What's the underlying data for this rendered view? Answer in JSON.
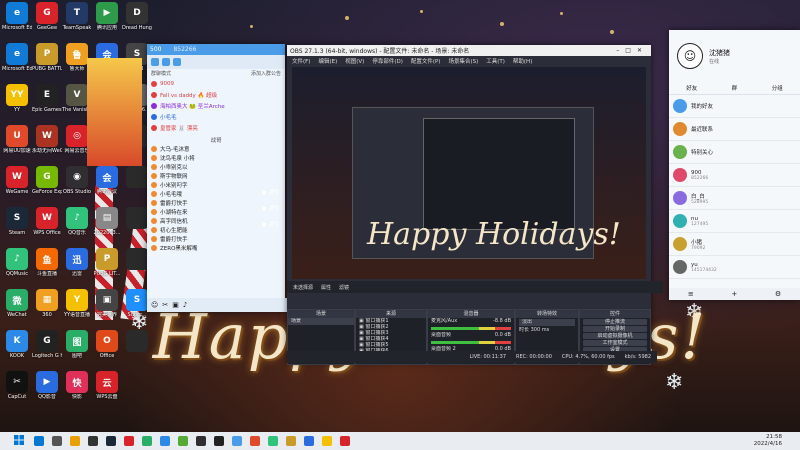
{
  "desktop_icons": [
    {
      "label": "Microsoft Edge",
      "color": "#0f7bd6",
      "glyph": "e"
    },
    {
      "label": "GeeGee",
      "color": "#d8232a",
      "glyph": "G"
    },
    {
      "label": "TeamSpeak",
      "color": "#233a66",
      "glyph": "T"
    },
    {
      "label": "腾讯应用",
      "color": "#2e9b4a",
      "glyph": "▶"
    },
    {
      "label": "Dread Hunger",
      "color": "#333",
      "glyph": "D"
    },
    {
      "label": "Microsoft Edge",
      "color": "#0f7bd6",
      "glyph": "e"
    },
    {
      "label": "PUBG BATTLEGR...",
      "color": "#c89b2a",
      "glyph": "P"
    },
    {
      "label": "鲁大师",
      "color": "#f0a020",
      "glyph": "鲁"
    },
    {
      "label": "腾讯会议",
      "color": "#2a6be0",
      "glyph": "会"
    },
    {
      "label": "SE5B",
      "color": "#444",
      "glyph": "S"
    },
    {
      "label": "YY",
      "color": "#f5c000",
      "glyph": "YY"
    },
    {
      "label": "Epic Games Launcher",
      "color": "#222",
      "glyph": "E"
    },
    {
      "label": "The Vanishing...",
      "color": "#554",
      "glyph": "V"
    },
    {
      "label": "KOOK",
      "color": "#2b8ae8",
      "glyph": "K"
    },
    {
      "label": "2022年6...",
      "color": "#666",
      "glyph": "W"
    },
    {
      "label": "网易UU加速",
      "color": "#e04a2a",
      "glyph": "U"
    },
    {
      "label": "永劫无间WeGame版",
      "color": "#a32",
      "glyph": "W"
    },
    {
      "label": "网易云音乐",
      "color": "#d8232a",
      "glyph": "◎"
    },
    {
      "label": "虎牙直播",
      "color": "#f5a800",
      "glyph": "虎"
    },
    {
      "label": "",
      "color": "#2a2a2a",
      "glyph": ""
    },
    {
      "label": "WeGame",
      "color": "#d8232a",
      "glyph": "W"
    },
    {
      "label": "GeForce Experience",
      "color": "#76b900",
      "glyph": "G"
    },
    {
      "label": "OBS Studio",
      "color": "#302e31",
      "glyph": "◉"
    },
    {
      "label": "腾讯会议",
      "color": "#2a6be0",
      "glyph": "会"
    },
    {
      "label": "",
      "color": "#2a2a2a",
      "glyph": ""
    },
    {
      "label": "Steam",
      "color": "#1b2838",
      "glyph": "S"
    },
    {
      "label": "WPS Office",
      "color": "#d8232a",
      "glyph": "W"
    },
    {
      "label": "QQ音乐",
      "color": "#31c27c",
      "glyph": "♪"
    },
    {
      "label": "2022063...",
      "color": "#888",
      "glyph": "▤"
    },
    {
      "label": "",
      "color": "#2a2a2a",
      "glyph": ""
    },
    {
      "label": "QQMusic",
      "color": "#31c27c",
      "glyph": "♪"
    },
    {
      "label": "斗鱼直播",
      "color": "#f56a00",
      "glyph": "鱼"
    },
    {
      "label": "迅雷",
      "color": "#2a6be0",
      "glyph": "迅"
    },
    {
      "label": "PUBG LIT...",
      "color": "#c89b2a",
      "glyph": "P"
    },
    {
      "label": "",
      "color": "#2a2a2a",
      "glyph": ""
    },
    {
      "label": "WeChat",
      "color": "#2aae67",
      "glyph": "微"
    },
    {
      "label": "360",
      "color": "#f0a020",
      "glyph": "▦"
    },
    {
      "label": "YY语音直播",
      "color": "#f5c000",
      "glyph": "Y"
    },
    {
      "label": "完美世界",
      "color": "#444",
      "glyph": "▣"
    },
    {
      "label": "Super...",
      "color": "#1e90ff",
      "glyph": "S"
    },
    {
      "label": "KOOK",
      "color": "#2b8ae8",
      "glyph": "K"
    },
    {
      "label": "Logitech G HUB",
      "color": "#222",
      "glyph": "G"
    },
    {
      "label": "图吧",
      "color": "#2aae67",
      "glyph": "图"
    },
    {
      "label": "Office",
      "color": "#e04a1a",
      "glyph": "O"
    },
    {
      "label": "",
      "color": "#2a2a2a",
      "glyph": ""
    },
    {
      "label": "CapCut",
      "color": "#111",
      "glyph": "✂"
    },
    {
      "label": "QQ影音",
      "color": "#2a6be0",
      "glyph": "▶"
    },
    {
      "label": "快影",
      "color": "#e0305a",
      "glyph": "快"
    },
    {
      "label": "WPS云盘",
      "color": "#d8232a",
      "glyph": "云"
    }
  ],
  "wallpaper": {
    "text": "Happy Holidays!"
  },
  "qq_chat": {
    "title": "500",
    "subtitle": "852266",
    "group_label": "群聊模式",
    "search_placeholder": "添加入群公告",
    "rows": [
      {
        "text": "9009",
        "color": "#e04040"
      },
      {
        "text": "Fall vs daddy 🔥 超级",
        "color": "#e04040"
      },
      {
        "text": "海帕西奥大 🐸 圣兰Arche",
        "color": "#8a2be2"
      },
      {
        "text": "小毛毛",
        "color": "#2a6be0"
      },
      {
        "text": "皇管家 🐰 漂亮",
        "color": "#e04040"
      }
    ],
    "section_head": "战哥",
    "members": [
      "大乌-毛沐意",
      "沈鸟毛泉 小将",
      "小乖别克以",
      "斯宇物联网",
      "小米别叼字",
      "小毛毛哦",
      "雷爵打快手",
      "小湖特在来",
      "高字同信机",
      "初心生肥能",
      "雷爵打快手",
      "ZERO黑米解嘴"
    ],
    "notice_items": [
      "通知",
      "通知",
      "通知"
    ]
  },
  "obs": {
    "title": "OBS 27.1.3 (64-bit, windows) - 配置文件: 未命名 - 场景: 未命名",
    "menu": [
      "文件(F)",
      "编辑(E)",
      "视图(V)",
      "停靠部件(D)",
      "配置文件(P)",
      "场景集合(S)",
      "工具(T)",
      "帮助(H)"
    ],
    "sub_tabs": [
      "未选择源",
      "属性",
      "滤镜"
    ],
    "dock_titles": [
      "场景",
      "来源",
      "混音器",
      "转场特效",
      "控件"
    ],
    "scene_items": [
      "场景"
    ],
    "source_items": [
      "窗口捕获1",
      "窗口捕获2",
      "窗口捕获3",
      "窗口捕获4",
      "窗口捕获5",
      "窗口捕获6",
      "窗口捕获7"
    ],
    "mixer_items": [
      {
        "name": "麦克风/Aux",
        "db": "-8.8 dB"
      },
      {
        "name": "桌面音频",
        "db": "0.0 dB"
      },
      {
        "name": "桌面音频 2",
        "db": "0.0 dB"
      }
    ],
    "transition": {
      "type": "淡出",
      "duration_label": "时长",
      "duration": "300 ms"
    },
    "controls": [
      "停止推流",
      "开始录制",
      "启动虚拟摄像机",
      "工作室模式",
      "设置",
      "退出"
    ],
    "status": {
      "live": "LIVE: 00:11:37",
      "rec": "REC: 00:00:00",
      "cpu": "CPU: 4.7%, 60.00 fps",
      "kbps": "kb/s: 5982"
    }
  },
  "friends": {
    "name": "沈猪猪",
    "status": "在线",
    "tabs": [
      "好友",
      "群",
      "分组"
    ],
    "items": [
      {
        "name": "我的好友",
        "sub": ""
      },
      {
        "name": "最近联系",
        "sub": ""
      },
      {
        "name": "特别关心",
        "sub": ""
      },
      {
        "name": "900",
        "sub": "852266"
      },
      {
        "name": "白_白",
        "sub": "528995"
      },
      {
        "name": "nu",
        "sub": "127495"
      },
      {
        "name": "小猪",
        "sub": "79092"
      },
      {
        "name": "yu",
        "sub": "145174432"
      }
    ]
  },
  "taskbar": {
    "icons": [
      "#0078d4",
      "#555",
      "#e9a000",
      "#333",
      "#1b2838",
      "#d8232a",
      "#2aae67",
      "#2b8ae8",
      "#5a3",
      "#302e31",
      "#222",
      "#4a9be8",
      "#e04a2a",
      "#31c27c",
      "#c89b2a",
      "#2a6be0",
      "#f5c000",
      "#d8232a"
    ],
    "time": "21:58",
    "date": "2022/4/16"
  }
}
